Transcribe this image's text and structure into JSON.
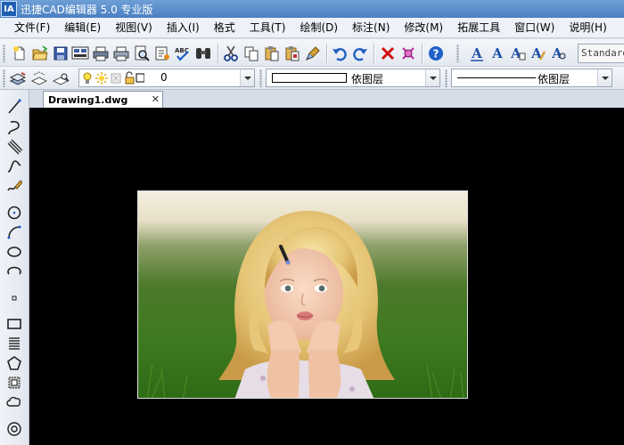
{
  "app": {
    "logo_text": "IA",
    "title": "迅捷CAD编辑器 5.0 专业版"
  },
  "menu": [
    "文件(F)",
    "编辑(E)",
    "视图(V)",
    "插入(I)",
    "格式",
    "工具(T)",
    "绘制(D)",
    "标注(N)",
    "修改(M)",
    "拓展工具",
    "窗口(W)",
    "说明(H)"
  ],
  "toolbar": {
    "spell_label": "ABC",
    "text_style": "Standard"
  },
  "layer_bar": {
    "layer_value": "0",
    "color_value": "依图层",
    "linetype_value": "依图层"
  },
  "tabs": [
    {
      "label": "Drawing1.dwg",
      "close": "✕"
    }
  ],
  "colors": {
    "accent": "#1f5fb0",
    "canvas": "#000000",
    "delete_red": "#d01010",
    "undo_blue": "#2060c0"
  },
  "icons": [
    "new-icon",
    "open-icon",
    "save-icon",
    "save-as-icon",
    "print-icon",
    "plot-icon",
    "preview-icon",
    "publish-icon",
    "spellcheck-icon",
    "find-icon",
    "cut-icon",
    "copy-icon",
    "paste-icon",
    "paste-special-icon",
    "match-properties-icon",
    "undo-icon",
    "redo-icon",
    "delete-icon",
    "erase-select-icon",
    "help-icon",
    "text-icon",
    "mtext-icon",
    "text-edit-icon",
    "text-style-icon",
    "text-find-icon"
  ]
}
